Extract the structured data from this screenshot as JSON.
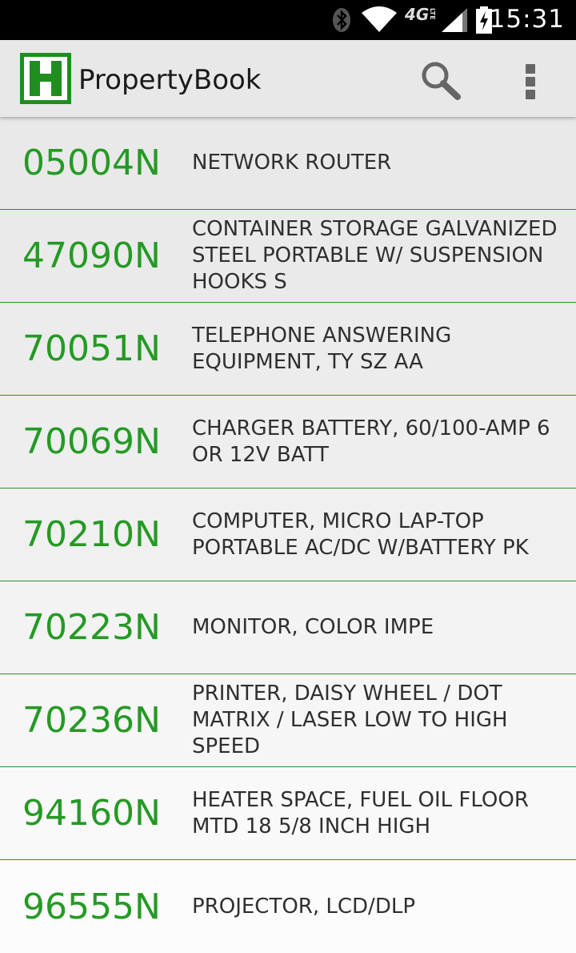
{
  "status_bar": {
    "time": "15:31",
    "icons": [
      "bluetooth-icon",
      "wifi-icon",
      "lte-4g-icon",
      "signal-icon",
      "battery-charging-icon"
    ],
    "network_label": "4G",
    "network_sublabel": "LTE"
  },
  "app_bar": {
    "title": "PropertyBook",
    "logo_letter": "H",
    "actions": [
      "search-icon",
      "overflow-menu-icon"
    ]
  },
  "colors": {
    "accent": "#249a24",
    "divider": "#2a922a",
    "logo_green": "#1f8e1f"
  },
  "items": [
    {
      "code": "05004N",
      "description": "NETWORK ROUTER"
    },
    {
      "code": "47090N",
      "description": "CONTAINER STORAGE GALVANIZED STEEL PORTABLE W/ SUSPENSION HOOKS S"
    },
    {
      "code": "70051N",
      "description": "TELEPHONE ANSWERING EQUIPMENT, TY SZ AA"
    },
    {
      "code": "70069N",
      "description": "CHARGER BATTERY, 60/100-AMP 6 OR 12V BATT"
    },
    {
      "code": "70210N",
      "description": "COMPUTER, MICRO LAP-TOP PORTABLE AC/DC W/BATTERY PK"
    },
    {
      "code": "70223N",
      "description": "MONITOR, COLOR IMPE"
    },
    {
      "code": "70236N",
      "description": "PRINTER, DAISY WHEEL / DOT MATRIX / LASER LOW TO HIGH SPEED"
    },
    {
      "code": "94160N",
      "description": "HEATER SPACE, FUEL OIL FLOOR MTD 18 5/8 INCH HIGH"
    },
    {
      "code": "96555N",
      "description": "PROJECTOR, LCD/DLP"
    }
  ]
}
